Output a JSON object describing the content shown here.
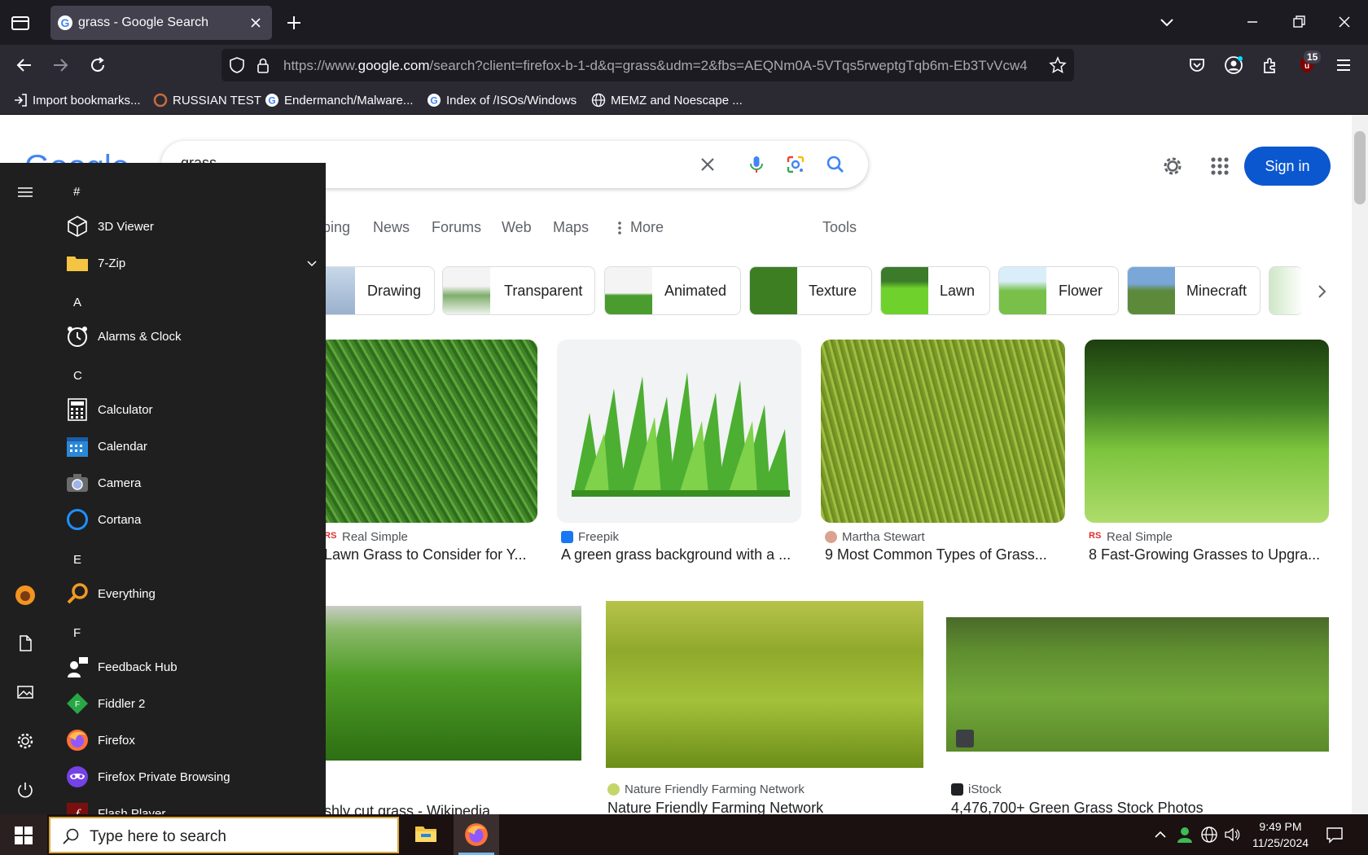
{
  "browser": {
    "tab_title": "grass - Google Search",
    "url_prefix": "https://www.",
    "url_domain": "google.com",
    "url_rest": "/search?client=firefox-b-1-d&q=grass&udm=2&fbs=AEQNm0A-5VTqs5rweptgTqb6m-Eb3TvVcw4",
    "extension_badge": "15",
    "bookmarks": [
      "Import bookmarks...",
      "RUSSIAN TEST",
      "Endermanch/Malware...",
      "Index of /ISOs/Windows",
      "MEMZ and Noescape ..."
    ]
  },
  "google": {
    "logo": "Google",
    "query": "grass",
    "sign_in": "Sign in",
    "tabs": [
      "ping",
      "News",
      "Forums",
      "Web",
      "Maps",
      "More",
      "Tools"
    ],
    "chips": [
      "Drawing",
      "Transparent",
      "Animated",
      "Texture",
      "Lawn",
      "Flower",
      "Minecraft"
    ],
    "results": [
      {
        "source": "Real Simple",
        "title": "Lawn Grass to Consider for Y..."
      },
      {
        "source": "Freepik",
        "title": "A green grass background with a ..."
      },
      {
        "source": "Martha Stewart",
        "title": "9 Most Common Types of Grass..."
      },
      {
        "source": "Real Simple",
        "title": "8 Fast-Growing Grasses to Upgra..."
      },
      {
        "source": "",
        "title": "shly cut grass - Wikipedia"
      },
      {
        "source": "Nature Friendly Farming Network",
        "title": "Nature Friendly Farming Network"
      },
      {
        "source": "iStock",
        "title": "4,476,700+ Green Grass Stock Photos"
      }
    ]
  },
  "start_menu": {
    "sections": [
      {
        "letter": "#",
        "apps": [
          "3D Viewer",
          "7-Zip"
        ]
      },
      {
        "letter": "A",
        "apps": [
          "Alarms & Clock"
        ]
      },
      {
        "letter": "C",
        "apps": [
          "Calculator",
          "Calendar",
          "Camera",
          "Cortana"
        ]
      },
      {
        "letter": "E",
        "apps": [
          "Everything"
        ]
      },
      {
        "letter": "F",
        "apps": [
          "Feedback Hub",
          "Fiddler 2",
          "Firefox",
          "Firefox Private Browsing",
          "Flash Player"
        ]
      }
    ]
  },
  "taskbar": {
    "search_placeholder": "Type here to search",
    "time": "9:49 PM",
    "date": "11/25/2024"
  },
  "colors": {
    "google_blue": "#0b57d0",
    "grass_green": "#4caf32",
    "taskbar_search_border": "#d8a83a"
  }
}
